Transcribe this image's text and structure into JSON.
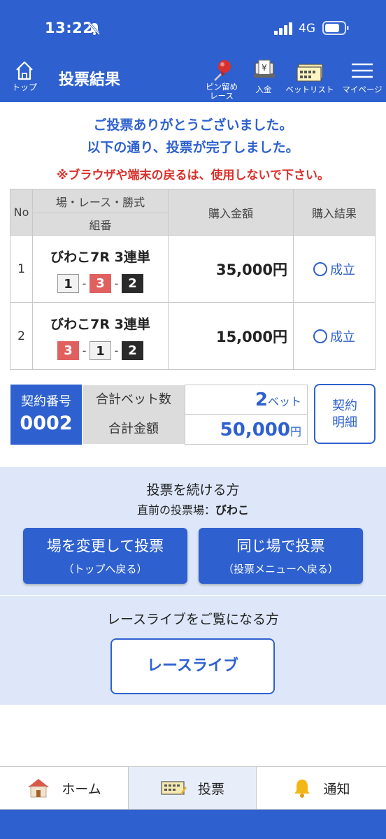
{
  "status": {
    "time": "13:22",
    "network": "4G"
  },
  "header": {
    "home_label": "トップ",
    "title": "投票結果",
    "nav": [
      {
        "label_line1": "ピン留め",
        "label_line2": "レース",
        "icon": "pin-icon"
      },
      {
        "label_line1": "入金",
        "label_line2": "",
        "icon": "deposit-icon"
      },
      {
        "label_line1": "ベットリスト",
        "label_line2": "",
        "icon": "betlist-icon"
      },
      {
        "label_line1": "マイページ",
        "label_line2": "",
        "icon": "menu-icon"
      }
    ]
  },
  "messages": {
    "thanks": "ご投票ありがとうございました。",
    "complete": "以下の通り、投票が完了しました。",
    "warning": "※ブラウザや端末の戻るは、使用しないで下さい。"
  },
  "table": {
    "headers": {
      "no": "No",
      "race": "場・レース・勝式",
      "combo": "組番",
      "amount": "購入金額",
      "result": "購入結果"
    },
    "rows": [
      {
        "no": "1",
        "race": "びわこ7R 3連単",
        "combo": [
          "1",
          "3",
          "2"
        ],
        "amount": "35,000円",
        "result": "成立"
      },
      {
        "no": "2",
        "race": "びわこ7R 3連単",
        "combo": [
          "3",
          "1",
          "2"
        ],
        "amount": "15,000円",
        "result": "成立"
      }
    ]
  },
  "summary": {
    "contract_label": "契約番号",
    "contract_no": "0002",
    "bet_count_label": "合計ベット数",
    "bet_count": "2",
    "bet_unit": "ベット",
    "total_label": "合計金額",
    "total": "50,000",
    "total_unit": "円",
    "detail_line1": "契約",
    "detail_line2": "明細"
  },
  "continue": {
    "title": "投票を続ける方",
    "prev_label": "直前の投票場：",
    "prev_venue": "びわこ",
    "change_main": "場を変更して投票",
    "change_sub": "（トップへ戻る）",
    "same_main": "同じ場で投票",
    "same_sub": "（投票メニューへ戻る）"
  },
  "live": {
    "title": "レースライブをご覧になる方",
    "button": "レースライブ"
  },
  "tabs": [
    {
      "label": "ホーム",
      "icon": "house-icon"
    },
    {
      "label": "投票",
      "icon": "ticket-icon"
    },
    {
      "label": "通知",
      "icon": "bell-icon"
    }
  ],
  "colors": {
    "primary": "#2e61cf",
    "warning": "#d9312b",
    "panel": "#dde7f9"
  }
}
